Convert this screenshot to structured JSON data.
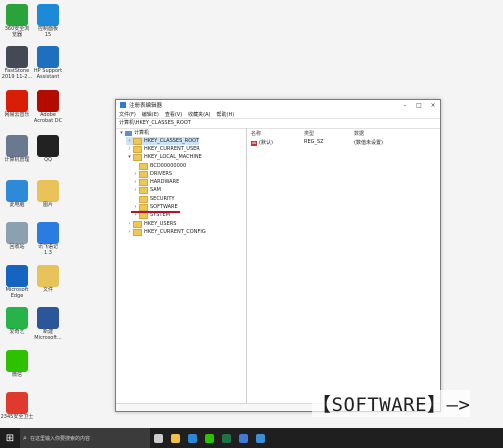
{
  "desktop": {
    "icons": [
      {
        "label": "360安全浏\n览器",
        "color": "#2aa43a"
      },
      {
        "label": "控制面板\n15",
        "color": "#1d8ad8"
      },
      {
        "label": "FastStone\n2019 11-2...",
        "color": "#444a55"
      },
      {
        "label": "HP Support\nAssistant",
        "color": "#1e6fc0"
      },
      {
        "label": "网易云音乐",
        "color": "#d81e06"
      },
      {
        "label": "Adobe\nAcrobat DC",
        "color": "#b30b00"
      },
      {
        "label": "计算机管理",
        "color": "#6a7890"
      },
      {
        "label": "QQ",
        "color": "#222222"
      },
      {
        "label": "此电脑",
        "color": "#2c8ad8"
      },
      {
        "label": "图片",
        "color": "#e8c35a"
      },
      {
        "label": "回收站",
        "color": "#8ba0b0"
      },
      {
        "label": "讯飞语记\n1.3",
        "color": "#2b7be0"
      },
      {
        "label": "Microsoft\nEdge",
        "color": "#1565c0"
      },
      {
        "label": "文件",
        "color": "#e8c35a"
      },
      {
        "label": "爱奇艺",
        "color": "#27b24a"
      },
      {
        "label": "新建\nMicrosoft...",
        "color": "#2b579a"
      },
      {
        "label": "微信",
        "color": "#2dc100"
      },
      {
        "label": "2345安全卫士",
        "color": "#e03a2f"
      }
    ]
  },
  "window": {
    "title": "注册表编辑器",
    "menu": [
      "文件(F)",
      "编辑(E)",
      "查看(V)",
      "收藏夹(A)",
      "帮助(H)"
    ],
    "address": "计算机\\HKEY_CLASSES_ROOT",
    "tree": [
      {
        "label": "计算机",
        "arrow": "▾"
      },
      {
        "label": "HKEY_CLASSES_ROOT",
        "arrow": "›"
      },
      {
        "label": "HKEY_CURRENT_USER",
        "arrow": "›"
      },
      {
        "label": "HKEY_LOCAL_MACHINE",
        "arrow": "▾"
      },
      {
        "label": "BCD00000000",
        "arrow": ""
      },
      {
        "label": "DRIVERS",
        "arrow": "›"
      },
      {
        "label": "HARDWARE",
        "arrow": "›"
      },
      {
        "label": "SAM",
        "arrow": "›"
      },
      {
        "label": "SECURITY",
        "arrow": ""
      },
      {
        "label": "SOFTWARE",
        "arrow": "›"
      },
      {
        "label": "SYSTEM",
        "arrow": "›"
      },
      {
        "label": "HKEY_USERS",
        "arrow": "›"
      },
      {
        "label": "HKEY_CURRENT_CONFIG",
        "arrow": "›"
      }
    ],
    "list_headers": {
      "name": "名称",
      "type": "类型",
      "data": "数据"
    },
    "list_rows": [
      {
        "name": "(默认)",
        "type": "REG_SZ",
        "data": "(数值未设置)"
      }
    ]
  },
  "annotation": "【SOFTWARE】—>",
  "taskbar": {
    "search_placeholder": "在这里输入你要搜索的内容",
    "icons": [
      {
        "name": "task-view-icon",
        "color": "#cccccc"
      },
      {
        "name": "explorer-icon",
        "color": "#f1c04a"
      },
      {
        "name": "edge-icon",
        "color": "#2a88d8"
      },
      {
        "name": "wechat-icon",
        "color": "#2dc100"
      },
      {
        "name": "excel-icon",
        "color": "#1f7244"
      },
      {
        "name": "photos-icon",
        "color": "#3f7ad6"
      },
      {
        "name": "regedit-icon",
        "color": "#3a8fd9"
      }
    ]
  }
}
